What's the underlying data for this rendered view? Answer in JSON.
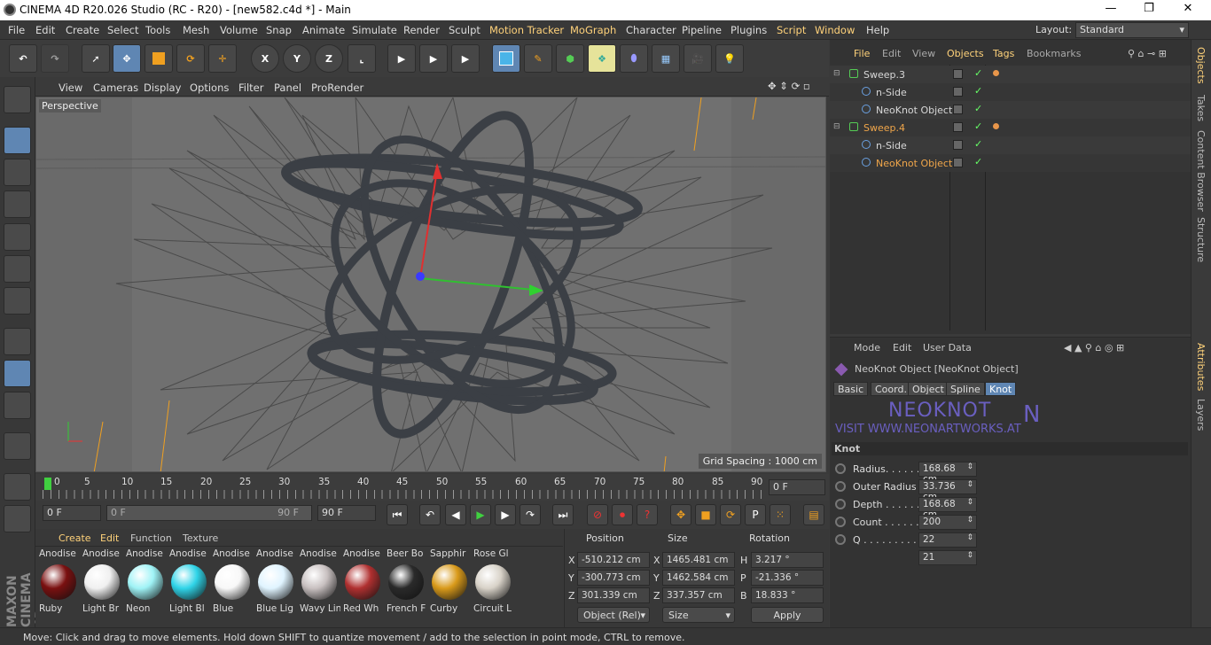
{
  "titlebar": {
    "title": "CINEMA 4D R20.026 Studio (RC - R20) - [new582.c4d *] - Main",
    "min": "—",
    "restore": "❐",
    "close": "✕"
  },
  "menu": [
    "File",
    "Edit",
    "Create",
    "Select",
    "Tools",
    "Mesh",
    "Volume",
    "Snap",
    "Animate",
    "Simulate",
    "Render",
    "Sculpt",
    "Motion Tracker",
    "MoGraph",
    "Character",
    "Pipeline",
    "Plugins",
    "Script",
    "Window",
    "Help"
  ],
  "layout": {
    "label": "Layout:",
    "value": "Standard"
  },
  "toolbar": {
    "x": "X",
    "y": "Y",
    "z": "Z"
  },
  "viewport": {
    "menu": [
      "View",
      "Cameras",
      "Display",
      "Options",
      "Filter",
      "Panel",
      "ProRender"
    ],
    "label": "Perspective",
    "grid_spacing": "Grid Spacing : 1000 cm"
  },
  "timeline": {
    "ticks": [
      "0",
      "5",
      "10",
      "15",
      "20",
      "25",
      "30",
      "35",
      "40",
      "45",
      "50",
      "55",
      "60",
      "65",
      "70",
      "75",
      "80",
      "85",
      "90"
    ],
    "current": "0 F"
  },
  "transport": {
    "start": "0 F",
    "range_start": "0 F",
    "range_end": "90 F",
    "end": "90 F"
  },
  "materials": {
    "menu": [
      "Create",
      "Edit",
      "Function",
      "Texture"
    ],
    "items": [
      {
        "top": "Anodise",
        "name": "Ruby",
        "color": "#7a1010"
      },
      {
        "top": "Anodise",
        "name": "Light Br",
        "color": "#f0f0f0"
      },
      {
        "top": "Anodise",
        "name": "Neon",
        "color": "#9ff3f6"
      },
      {
        "top": "Anodise",
        "name": "Light Bl",
        "color": "#2fd4e8"
      },
      {
        "top": "Anodise",
        "name": "Blue",
        "color": "#f8f8f8"
      },
      {
        "top": "Anodise",
        "name": "Blue Lig",
        "color": "#e0f4ff"
      },
      {
        "top": "Anodise",
        "name": "Wavy Lin",
        "color": "#c8c0c0"
      },
      {
        "top": "Anodise",
        "name": "Red Wh",
        "color": "#b03030"
      },
      {
        "top": "Beer Bo",
        "name": "French F",
        "color": "#2a2a2a"
      },
      {
        "top": "Sapphir",
        "name": "Curby",
        "color": "#d99a1a"
      },
      {
        "top": "Rose Gl",
        "name": "Circuit L",
        "color": "#d8d2c8"
      }
    ]
  },
  "coords": {
    "headers": [
      "Position",
      "Size",
      "Rotation"
    ],
    "rows": [
      {
        "axis": "X",
        "pos": "-510.212 cm",
        "size_axis": "X",
        "size": "1465.481 cm",
        "rot_axis": "H",
        "rot": "3.217 °"
      },
      {
        "axis": "Y",
        "pos": "-300.773 cm",
        "size_axis": "Y",
        "size": "1462.584 cm",
        "rot_axis": "P",
        "rot": "-21.336 °"
      },
      {
        "axis": "Z",
        "pos": "301.339 cm",
        "size_axis": "Z",
        "size": "337.357 cm",
        "rot_axis": "B",
        "rot": "18.833 °"
      }
    ],
    "mode": "Object (Rel)",
    "size_mode": "Size",
    "apply": "Apply"
  },
  "objects": {
    "menu": [
      "File",
      "Edit",
      "View",
      "Objects",
      "Tags",
      "Bookmarks"
    ],
    "rows": [
      {
        "name": "Sweep.3",
        "indent": 0,
        "color": "#d8d8d8",
        "tag": true
      },
      {
        "name": "n-Side",
        "indent": 1,
        "color": "#d8d8d8",
        "tag": false
      },
      {
        "name": "NeoKnot Object",
        "indent": 1,
        "color": "#d8d8d8",
        "tag": false
      },
      {
        "name": "Sweep.4",
        "indent": 0,
        "color": "#f0a64a",
        "tag": true
      },
      {
        "name": "n-Side",
        "indent": 1,
        "color": "#d8d8d8",
        "tag": false
      },
      {
        "name": "NeoKnot Object",
        "indent": 1,
        "color": "#f0a64a",
        "tag": false
      }
    ]
  },
  "right_tabs": [
    "Objects",
    "Takes",
    "Content Browser",
    "Structure",
    "Attributes",
    "Layers"
  ],
  "attributes": {
    "menu": [
      "Mode",
      "Edit",
      "User Data"
    ],
    "object_title": "NeoKnot Object [NeoKnot Object]",
    "tabs": [
      "Basic",
      "Coord.",
      "Object",
      "Spline",
      "Knot"
    ],
    "banner_title": "NEOKNOT",
    "banner_url": "VISIT WWW.NEONARTWORKS.AT",
    "section": "Knot",
    "params": [
      {
        "label": "Radius. . . . . .",
        "value": "168.68 cm"
      },
      {
        "label": "Outer Radius",
        "value": "33.736 cm"
      },
      {
        "label": "Depth . . . . . .",
        "value": "168.68 cm"
      },
      {
        "label": "Count . . . . . .",
        "value": "200"
      },
      {
        "label": "Q . . . . . . . . . .",
        "value": "22"
      },
      {
        "label": "",
        "value": "21"
      }
    ]
  },
  "status": "Move: Click and drag to move elements. Hold down SHIFT to quantize movement / add to the selection in point mode, CTRL to remove."
}
